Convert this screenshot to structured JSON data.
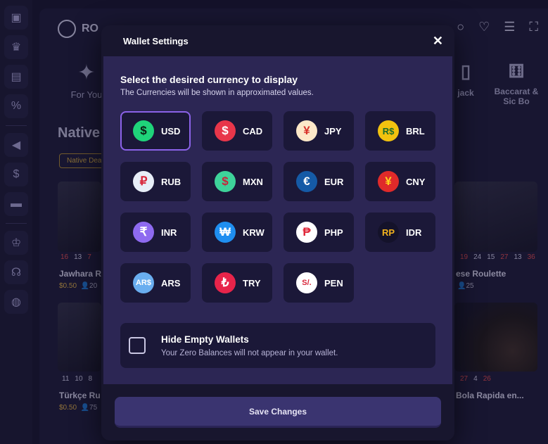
{
  "background": {
    "logo_text": "RO",
    "categories": {
      "for_you": "For You",
      "blackjack": "jack",
      "baccarat_line1": "Baccarat &",
      "baccarat_line2": "Sic Bo"
    },
    "section_title": "Native",
    "filter_chip": "Native Dea",
    "cards": {
      "jawhara_title": "Jawhara R",
      "jawhara_price": "$0.50",
      "jawhara_players": "20",
      "roulette_title": "ese Roulette",
      "roulette_players": "25",
      "turkce_title": "Türkçe Ru",
      "turkce_price": "$0.50",
      "turkce_players": "75",
      "bola_title": "Bola Rapida en...",
      "numbers_left": [
        "16",
        "13",
        "7"
      ],
      "numbers_right": [
        "19",
        "24",
        "15",
        "27",
        "13",
        "36"
      ],
      "numbers_left2": [
        "11",
        "10",
        "8"
      ],
      "numbers_right2": [
        "27",
        "4",
        "26"
      ]
    }
  },
  "modal": {
    "title": "Wallet Settings",
    "heading": "Select the desired currency to display",
    "subheading": "The Currencies will be shown in approximated values.",
    "selected_currency": "USD",
    "currencies": [
      {
        "code": "USD",
        "symbol": "$",
        "bg": "#1fd47a",
        "fg": "#0b1f14"
      },
      {
        "code": "CAD",
        "symbol": "$",
        "bg": "#e8364a",
        "fg": "#ffffff"
      },
      {
        "code": "JPY",
        "symbol": "¥",
        "bg": "#fde8c8",
        "fg": "#d8322a"
      },
      {
        "code": "BRL",
        "symbol": "R$",
        "bg": "#f2c20f",
        "fg": "#1a6b2a"
      },
      {
        "code": "RUB",
        "symbol": "₽",
        "bg": "#e8eef8",
        "fg": "#d8263a"
      },
      {
        "code": "MXN",
        "symbol": "$",
        "bg": "#3ed39a",
        "fg": "#c8243a"
      },
      {
        "code": "EUR",
        "symbol": "€",
        "bg": "#155aa6",
        "fg": "#ffffff"
      },
      {
        "code": "CNY",
        "symbol": "¥",
        "bg": "#e02a2a",
        "fg": "#ffd21e"
      },
      {
        "code": "INR",
        "symbol": "₹",
        "bg": "#8e6af0",
        "fg": "#ffffff"
      },
      {
        "code": "KRW",
        "symbol": "₩",
        "bg": "#1f8ef0",
        "fg": "#ffffff"
      },
      {
        "code": "PHP",
        "symbol": "₱",
        "bg": "#ffffff",
        "fg": "#e0283a"
      },
      {
        "code": "IDR",
        "symbol": "RP",
        "bg": "#14122a",
        "fg": "#f2b21e"
      },
      {
        "code": "ARS",
        "symbol": "AR$",
        "bg": "#6aaef0",
        "fg": "#ffffff"
      },
      {
        "code": "TRY",
        "symbol": "₺",
        "bg": "#e8244a",
        "fg": "#ffffff"
      },
      {
        "code": "PEN",
        "symbol": "S/.",
        "bg": "#ffffff",
        "fg": "#d8263a"
      }
    ],
    "hide_empty": {
      "title": "Hide Empty Wallets",
      "description": "Your Zero Balances will not appear in your wallet."
    },
    "save_label": "Save Changes"
  },
  "colors": {
    "accent": "#8b62e8",
    "modal_body": "#2c2654",
    "button_bg": "#1b1838"
  }
}
